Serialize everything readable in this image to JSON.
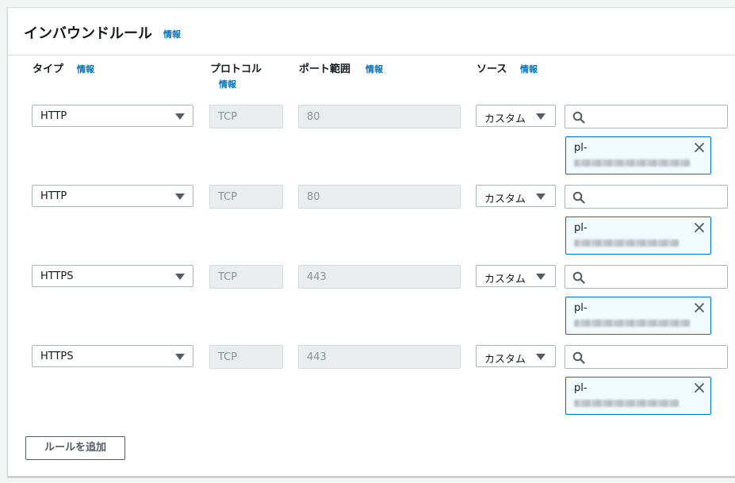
{
  "panel": {
    "title": "インバウンドルール",
    "info_label": "情報"
  },
  "columns": {
    "type": {
      "label": "タイプ",
      "info": "情報"
    },
    "protocol": {
      "label": "プロトコル",
      "info": "情報"
    },
    "port_range": {
      "label": "ポート範囲",
      "info": "情報"
    },
    "source": {
      "label": "ソース",
      "info": "情報"
    }
  },
  "rules": [
    {
      "type": "HTTP",
      "protocol": "TCP",
      "port": "80",
      "source": "カスタム",
      "search_value": "",
      "token_prefix": "pl-"
    },
    {
      "type": "HTTP",
      "protocol": "TCP",
      "port": "80",
      "source": "カスタム",
      "search_value": "",
      "token_prefix": "pl-"
    },
    {
      "type": "HTTPS",
      "protocol": "TCP",
      "port": "443",
      "source": "カスタム",
      "search_value": "",
      "token_prefix": "pl-"
    },
    {
      "type": "HTTPS",
      "protocol": "TCP",
      "port": "443",
      "source": "カスタム",
      "search_value": "",
      "token_prefix": "pl-"
    }
  ],
  "actions": {
    "add_rule_label": "ルールを追加"
  },
  "icons": {
    "dropdown": "caret-down-icon",
    "search": "search-icon",
    "remove_token": "close-icon"
  },
  "colors": {
    "link": "#0073bb",
    "token_border": "#0073bb",
    "token_background": "#f1faff",
    "disabled_background": "#eaeded"
  }
}
